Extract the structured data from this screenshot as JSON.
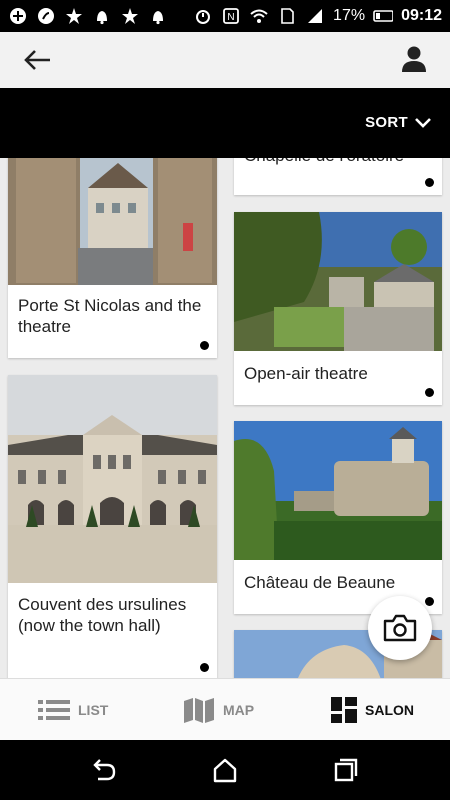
{
  "status_bar": {
    "battery": "17%",
    "time": "09:12",
    "icons": [
      "add-box-icon",
      "shazam-icon",
      "star-icon",
      "bell-icon",
      "star-icon",
      "bell-icon",
      "alarm-icon",
      "nfc-icon",
      "wifi-icon",
      "sim-icon",
      "signal-icon",
      "battery-icon"
    ]
  },
  "header": {
    "back_icon": "arrow-left-icon",
    "user_icon": "user-icon"
  },
  "sort": {
    "label": "SORT",
    "icon": "chevron-down-icon"
  },
  "cards": {
    "chapelle": "Chapelle de l'oratoire",
    "porte": "Porte St Nicolas and the theatre",
    "open_air": "Open-air theatre",
    "couvent": "Couvent des ursulines (now the town hall)",
    "chateau": "Château de Beaune"
  },
  "bottom_nav": {
    "list_label": "LIST",
    "map_label": "MAP",
    "salon_label": "SALON",
    "active": "SALON"
  },
  "colors": {
    "accent": "#000000",
    "inactive": "#8a8a8a",
    "background": "#ececec"
  }
}
